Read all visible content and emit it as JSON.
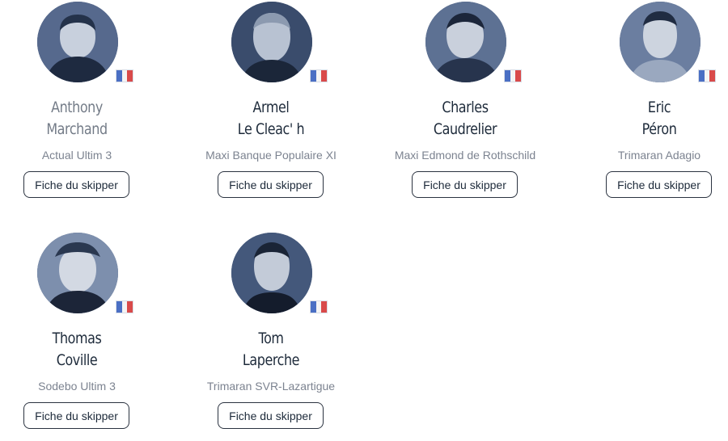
{
  "skippers": [
    {
      "first": "Anthony",
      "last": "Marchand",
      "boat": "Actual Ultim 3",
      "button": "Fiche du skipper",
      "flag": "france-flag-icon"
    },
    {
      "first": "Armel",
      "last": "Le Cleac' h",
      "boat": "Maxi Banque Populaire XI",
      "button": "Fiche du skipper",
      "flag": "france-flag-icon"
    },
    {
      "first": "Charles",
      "last": "Caudrelier",
      "boat": "Maxi Edmond de Rothschild",
      "button": "Fiche du skipper",
      "flag": "france-flag-icon"
    },
    {
      "first": "Eric",
      "last": "Péron",
      "boat": "Trimaran Adagio",
      "button": "Fiche du skipper",
      "flag": "france-flag-icon"
    },
    {
      "first": "Thomas",
      "last": "Coville",
      "boat": "Sodebo Ultim 3",
      "button": "Fiche du skipper",
      "flag": "france-flag-icon"
    },
    {
      "first": "Tom",
      "last": "Laperche",
      "boat": "Trimaran SVR-Lazartigue",
      "button": "Fiche du skipper",
      "flag": "france-flag-icon"
    }
  ],
  "colors": {
    "avatar_tint": "#3e5275",
    "name_text": "#1d2a3a",
    "name_hover": "#737b87",
    "boat_text": "#7c8390",
    "button_border": "#2b3340"
  }
}
